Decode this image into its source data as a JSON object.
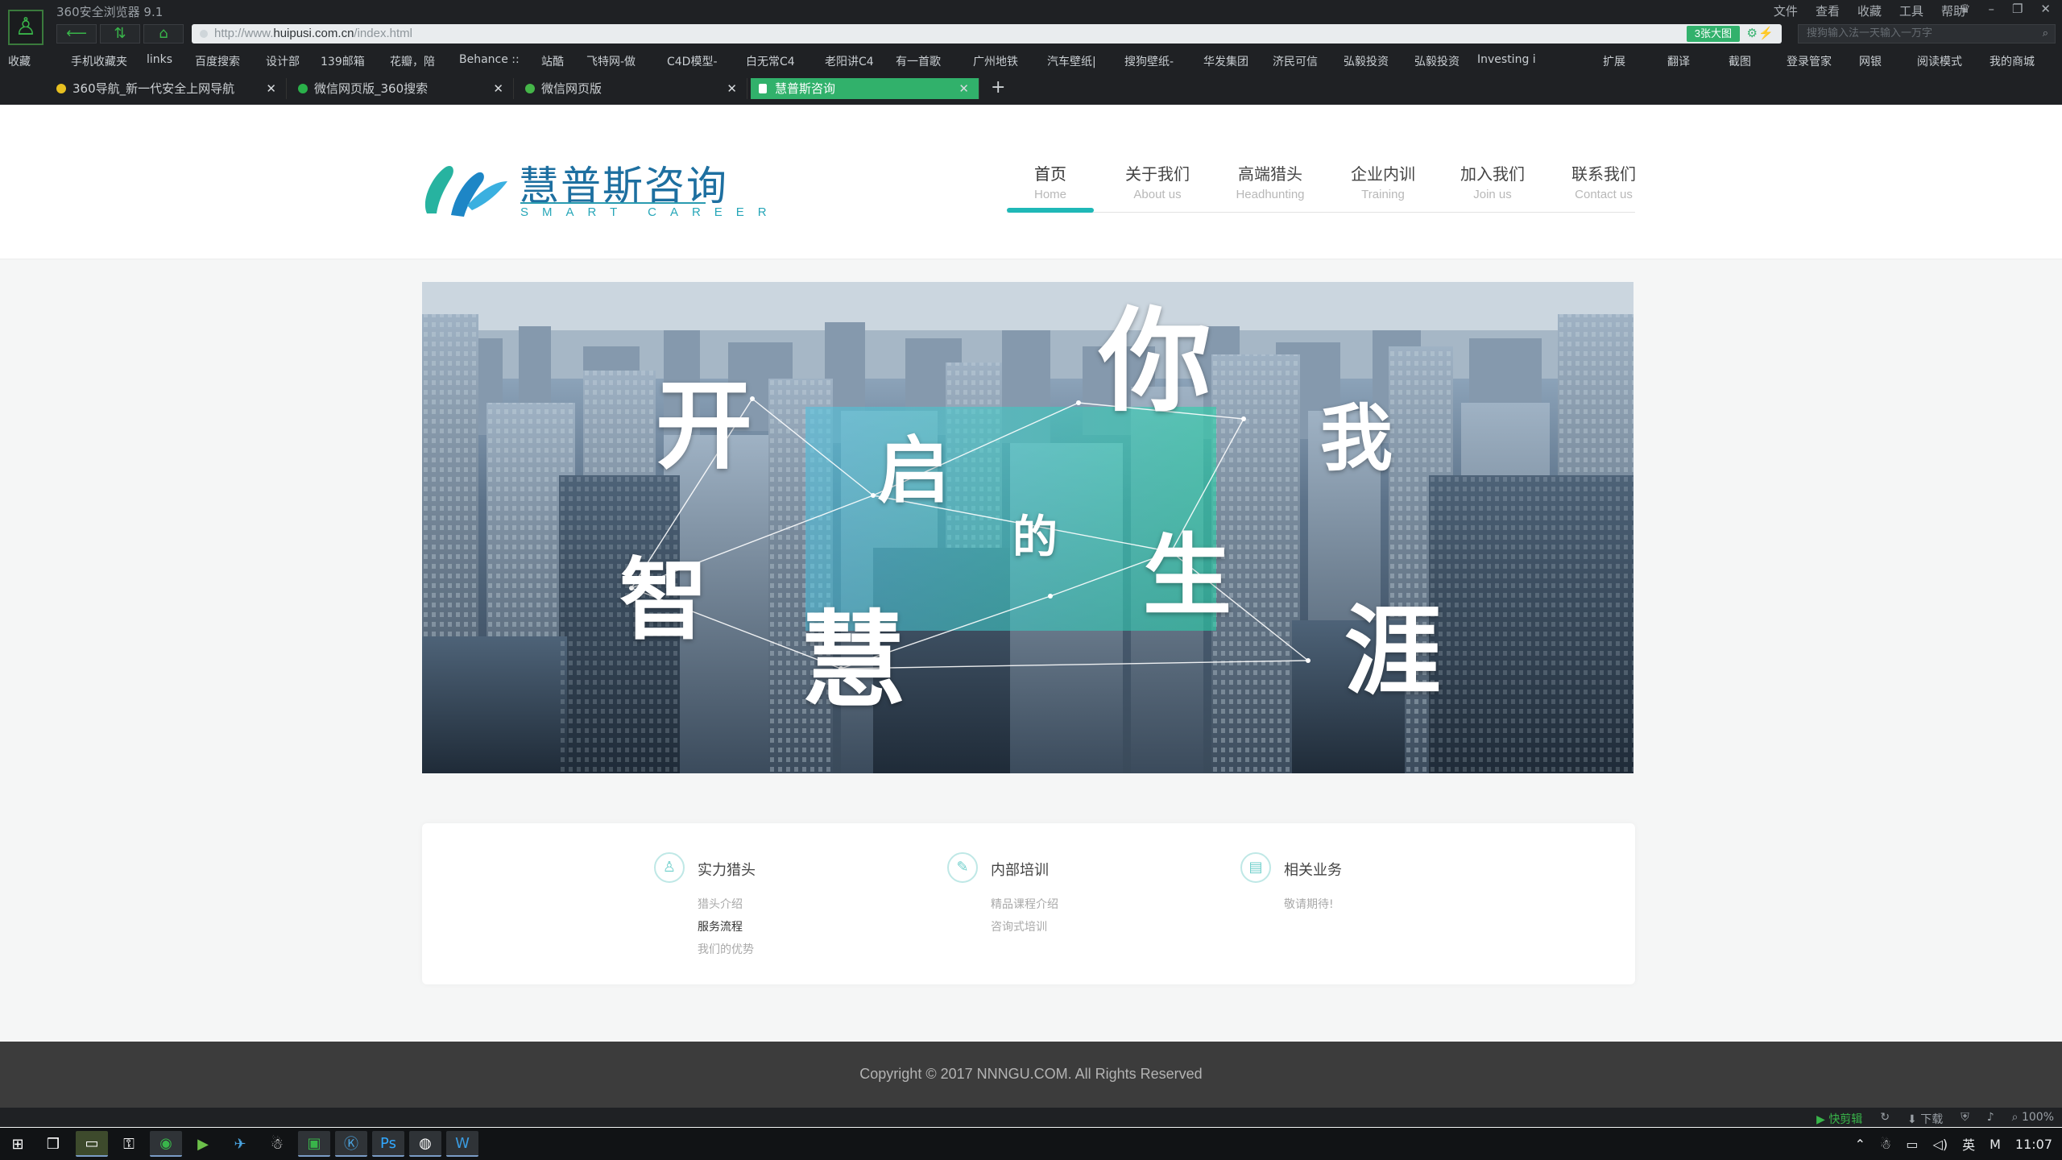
{
  "browser": {
    "app_title": "360安全浏览器 9.1",
    "menus": [
      "文件",
      "查看",
      "收藏",
      "工具",
      "帮助"
    ],
    "address": {
      "prefix": "http://www.",
      "domain": "huipusi.com.cn",
      "path": "/index.html"
    },
    "big_image_label": "3张大图",
    "search_placeholder": "搜狗输入法一天输入一万字",
    "bookmarks": [
      "收藏",
      "手机收藏夹",
      "links",
      "百度搜索",
      "设计部",
      "139邮箱",
      "花瓣，陪",
      "Behance ::",
      "站酷",
      "飞特网-做",
      "C4D模型-",
      "白无常C4",
      "老阳讲C4",
      "有一首歌",
      "广州地铁",
      "汽车壁纸|",
      "搜狗壁纸-",
      "华发集团",
      "济民可信",
      "弘毅投资",
      "弘毅投资",
      "Investing i",
      "扩展",
      "翻译",
      "截图",
      "登录管家",
      "网银",
      "阅读模式",
      "我的商城"
    ],
    "tabs": [
      {
        "label": "360导航_新一代安全上网导航",
        "active": false
      },
      {
        "label": "微信网页版_360搜索",
        "active": false
      },
      {
        "label": "微信网页版",
        "active": false
      },
      {
        "label": "慧普斯咨询",
        "active": true
      }
    ],
    "status": {
      "quick_cut": "快剪辑",
      "download": "下载",
      "zoom": "100%"
    }
  },
  "site": {
    "logo": {
      "name_cn": "慧普斯咨询",
      "name_en": "SMART CAREER"
    },
    "nav": [
      {
        "cn": "首页",
        "en": "Home",
        "active": true
      },
      {
        "cn": "关于我们",
        "en": "About us",
        "active": false
      },
      {
        "cn": "高端猎头",
        "en": "Headhunting",
        "active": false
      },
      {
        "cn": "企业内训",
        "en": "Training",
        "active": false
      },
      {
        "cn": "加入我们",
        "en": "Join us",
        "active": false
      },
      {
        "cn": "联系我们",
        "en": "Contact us",
        "active": false
      }
    ],
    "banner": {
      "chars": {
        "kai": "开",
        "qi": "启",
        "ni": "你",
        "wo": "我",
        "de": "的",
        "sheng": "生",
        "zhi": "智",
        "hui": "慧",
        "ya": "涯"
      }
    },
    "services": [
      {
        "title": "实力猎头",
        "icon": "user-icon",
        "links": [
          {
            "label": "猎头介绍",
            "hl": false
          },
          {
            "label": "服务流程",
            "hl": true
          },
          {
            "label": "我们的优势",
            "hl": false
          }
        ]
      },
      {
        "title": "内部培训",
        "icon": "pencil-icon",
        "links": [
          {
            "label": "精品课程介绍",
            "hl": false
          },
          {
            "label": "咨询式培训",
            "hl": false
          }
        ]
      },
      {
        "title": "相关业务",
        "icon": "folder-icon",
        "links": [
          {
            "label": "敬请期待!",
            "hl": false
          }
        ]
      }
    ],
    "footer": {
      "copyright": "Copyright © 2017 NNNGU.COM. All Rights Reserved"
    }
  },
  "taskbar": {
    "tray": {
      "ime": "英",
      "ime2": "M",
      "time": "11:07"
    }
  },
  "colors": {
    "accent": "#1fb8b7",
    "tab_active": "#31b16b",
    "logo_blue": "#1d6fa0"
  }
}
